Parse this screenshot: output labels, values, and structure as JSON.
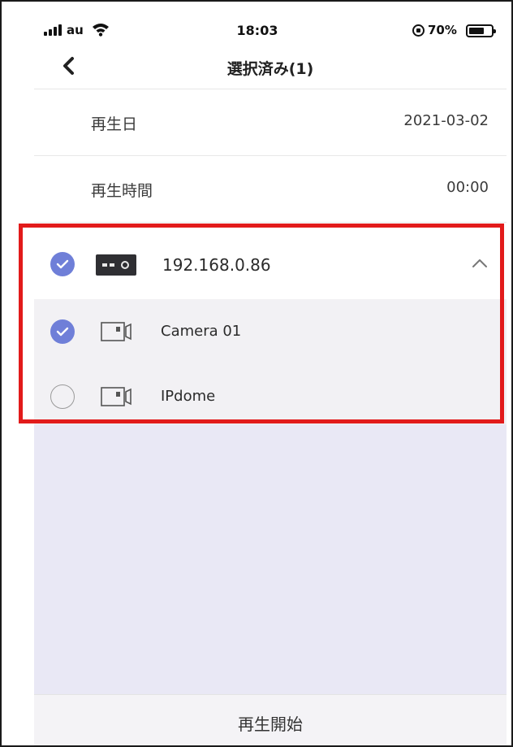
{
  "status_bar": {
    "carrier": "au",
    "time": "18:03",
    "battery_percent": "70%",
    "battery_level": 0.7,
    "icons": [
      "signal-icon",
      "wifi-icon",
      "rotation-lock-icon",
      "battery-icon"
    ]
  },
  "nav": {
    "back_icon": "chevron-left-icon",
    "title": "選択済み(1)"
  },
  "settings": {
    "date_label": "再生日",
    "date_value": "2021-03-02",
    "time_label": "再生時間",
    "time_value": "00:00"
  },
  "device": {
    "name": "192.168.0.86",
    "checked": true,
    "expanded": true,
    "icon": "nvr-icon",
    "channels": [
      {
        "name": "Camera 01",
        "checked": true,
        "icon": "camera-icon"
      },
      {
        "name": "IPdome",
        "checked": false,
        "icon": "camera-icon"
      }
    ]
  },
  "footer": {
    "start_label": "再生開始"
  },
  "colors": {
    "accent": "#6f7fd8",
    "highlight_border": "#e21b1b",
    "empty_area": "#e9e8f5",
    "channel_bg": "#f2f1f4"
  }
}
